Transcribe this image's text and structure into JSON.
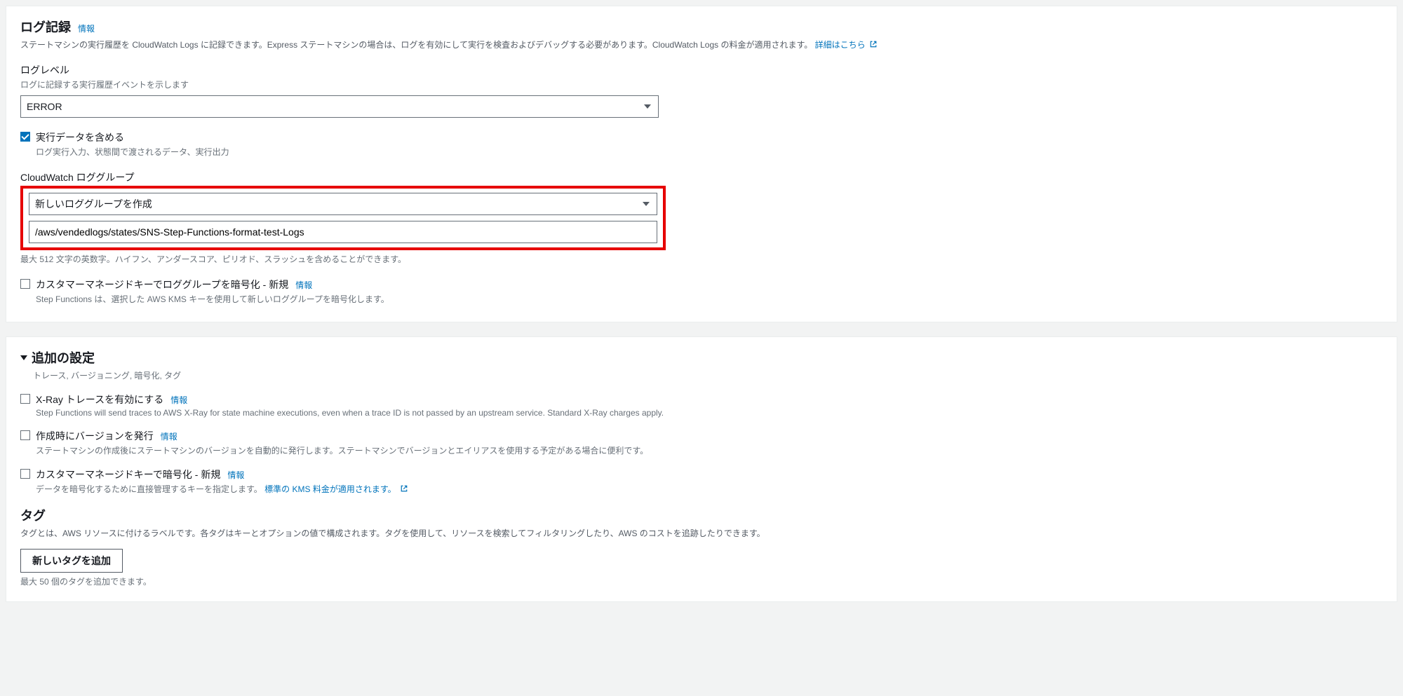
{
  "log_section": {
    "title": "ログ記録",
    "info_label": "情報",
    "description": "ステートマシンの実行履歴を CloudWatch Logs に記録できます。Express ステートマシンの場合は、ログを有効にして実行を検査およびデバッグする必要があります。CloudWatch Logs の料金が適用されます。",
    "learn_more": "詳細はこちら",
    "log_level": {
      "label": "ログレベル",
      "desc": "ログに記録する実行履歴イベントを示します",
      "value": "ERROR"
    },
    "include_exec": {
      "label": "実行データを含める",
      "desc": "ログ実行入力、状態間で渡されるデータ、実行出力",
      "checked": true
    },
    "log_group": {
      "label": "CloudWatch ロググループ",
      "select_value": "新しいロググループを作成",
      "input_value": "/aws/vendedlogs/states/SNS-Step-Functions-format-test-Logs",
      "hint": "最大 512 文字の英数字。ハイフン、アンダースコア、ピリオド、スラッシュを含めることができます。"
    },
    "kms_encrypt": {
      "label": "カスタマーマネージドキーでロググループを暗号化 - 新規",
      "info_label": "情報",
      "desc": "Step Functions は、選択した AWS KMS キーを使用して新しいロググループを暗号化します。",
      "checked": false
    }
  },
  "additional": {
    "title": "追加の設定",
    "sub": "トレース, バージョニング, 暗号化, タグ",
    "xray": {
      "label": "X-Ray トレースを有効にする",
      "info_label": "情報",
      "desc": "Step Functions will send traces to AWS X-Ray for state machine executions, even when a trace ID is not passed by an upstream service. Standard X-Ray charges apply.",
      "checked": false
    },
    "version": {
      "label": "作成時にバージョンを発行",
      "info_label": "情報",
      "desc": "ステートマシンの作成後にステートマシンのバージョンを自動的に発行します。ステートマシンでバージョンとエイリアスを使用する予定がある場合に便利です。",
      "checked": false
    },
    "cmk": {
      "label": "カスタマーマネージドキーで暗号化 - 新規",
      "info_label": "情報",
      "desc_prefix": "データを暗号化するために直接管理するキーを指定します。",
      "kms_link": "標準の KMS 料金が適用されます。",
      "checked": false
    },
    "tags": {
      "title": "タグ",
      "desc": "タグとは、AWS リソースに付けるラベルです。各タグはキーとオプションの値で構成されます。タグを使用して、リソースを検索してフィルタリングしたり、AWS のコストを追跡したりできます。",
      "add_btn": "新しいタグを追加",
      "limit": "最大 50 個のタグを追加できます。"
    }
  }
}
